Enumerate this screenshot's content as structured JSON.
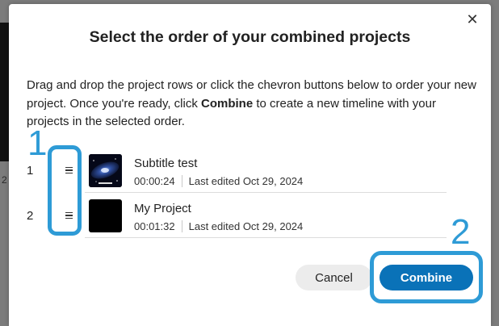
{
  "background": {
    "partial_text": "2"
  },
  "dialog": {
    "title": "Select the order of your combined projects",
    "close_icon": "close-icon",
    "description_1": "Drag and drop the project rows or click the chevron buttons below to order your new project. Once you're ready, click ",
    "description_bold": "Combine",
    "description_2": " to create a new timeline with your projects in the selected order.",
    "projects": [
      {
        "order": "1",
        "name": "Subtitle test",
        "duration": "00:00:24",
        "edited": "Last edited Oct 29, 2024",
        "thumbnail": "galaxy"
      },
      {
        "order": "2",
        "name": "My Project",
        "duration": "00:01:32",
        "edited": "Last edited Oct 29, 2024",
        "thumbnail": "black"
      }
    ],
    "cancel_label": "Cancel",
    "combine_label": "Combine"
  },
  "annotations": {
    "label_1": "1",
    "label_2": "2",
    "color": "#2e9bd6"
  },
  "colors": {
    "primary": "#0a72b8",
    "secondary_button": "#ececec"
  }
}
